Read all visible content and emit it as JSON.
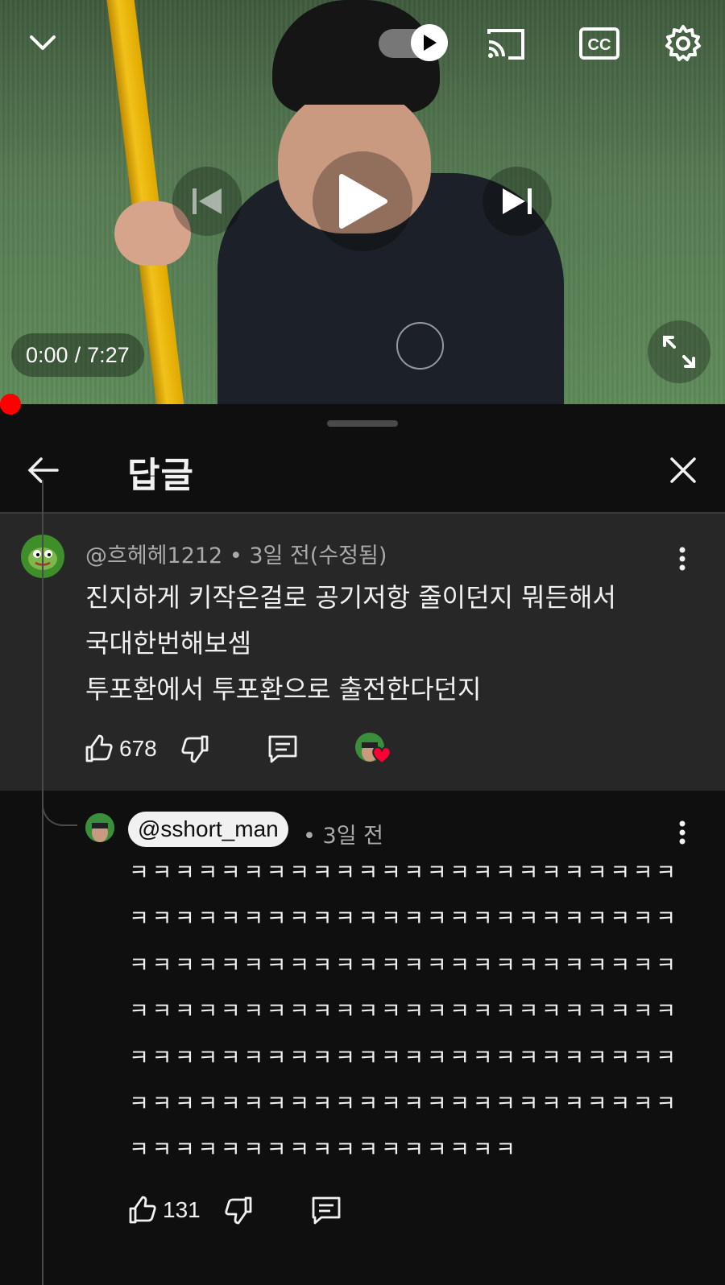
{
  "player": {
    "time_current": "0:00",
    "time_separator": "/",
    "time_total": "7:27",
    "autoplay_on": true,
    "progress_fraction": 0.0,
    "icons": [
      "chevron-down-icon",
      "autoplay-toggle-icon",
      "cast-icon",
      "cc-icon",
      "gear-icon",
      "skip-previous-icon",
      "play-icon",
      "skip-next-icon",
      "fullscreen-icon"
    ]
  },
  "panel": {
    "title": "답글",
    "back_icon": "arrow-left-icon",
    "close_icon": "close-icon"
  },
  "parent_comment": {
    "author": "@흐헤헤1212",
    "separator": "•",
    "time": "3일 전(수정됨)",
    "lines": [
      "진지하게 키작은걸로 공기저항 줄이던지 뭐든해서",
      "국대한번해보셈",
      "투포환에서 투포환으로 출전한다던지"
    ],
    "likes": "678",
    "creator_hearted": true
  },
  "reply": {
    "author": "@sshort_man",
    "separator": "•",
    "time": "3일 전",
    "text": "ㅋㅋㅋㅋㅋㅋㅋㅋㅋㅋㅋㅋㅋㅋㅋㅋㅋㅋㅋㅋㅋㅋㅋㅋㅋㅋㅋㅋㅋㅋㅋㅋㅋㅋㅋㅋㅋㅋㅋㅋㅋㅋㅋㅋㅋㅋㅋㅋㅋㅋㅋㅋㅋㅋㅋㅋㅋㅋㅋㅋㅋㅋㅋㅋㅋㅋㅋㅋㅋㅋㅋㅋㅋㅋㅋㅋㅋㅋㅋㅋㅋㅋㅋㅋㅋㅋㅋㅋㅋㅋㅋㅋㅋㅋㅋㅋㅋㅋㅋㅋㅋㅋㅋㅋㅋㅋㅋㅋㅋㅋㅋㅋㅋㅋㅋㅋㅋㅋㅋㅋㅋㅋㅋㅋㅋㅋㅋㅋㅋㅋㅋㅋㅋㅋㅋㅋㅋㅋㅋㅋㅋㅋㅋㅋㅋㅋㅋㅋㅋㅋㅋㅋㅋㅋㅋㅋㅋㅋㅋㅋㅋ",
    "likes": "131"
  },
  "colors": {
    "background": "#0f0f0f",
    "parent_highlight": "#272727",
    "progress": "#ff0000",
    "secondary_text": "#aaaaaa",
    "heart": "#ff0033"
  }
}
